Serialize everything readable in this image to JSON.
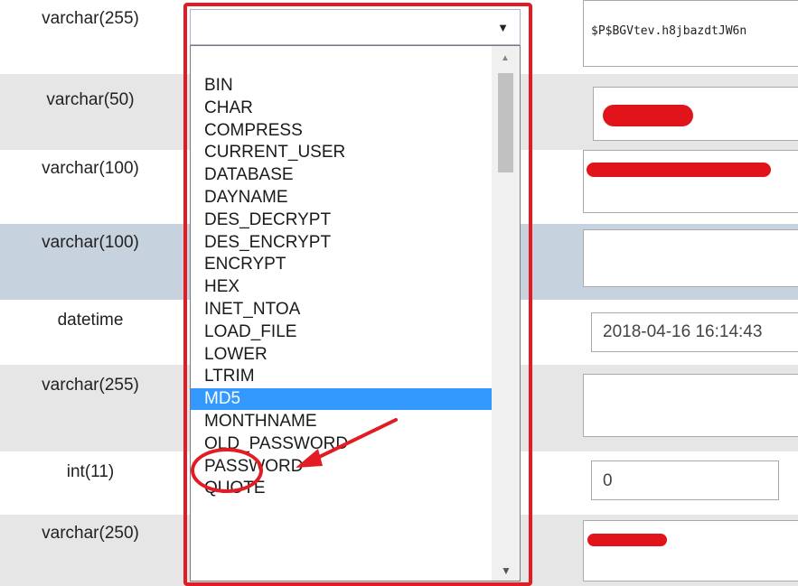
{
  "rows": [
    {
      "type": "varchar(255)",
      "value": "$P$BGVtev.h8jbazdtJW6n"
    },
    {
      "type": "varchar(50)",
      "value": ""
    },
    {
      "type": "varchar(100)",
      "value": ""
    },
    {
      "type": "varchar(100)",
      "value": ""
    },
    {
      "type": "datetime",
      "value": "2018-04-16 16:14:43"
    },
    {
      "type": "varchar(255)",
      "value": ""
    },
    {
      "type": "int(11)",
      "value": "0"
    },
    {
      "type": "varchar(250)",
      "value": ""
    }
  ],
  "function_select": {
    "value": "",
    "arrow": "▼",
    "options": [
      "BIN",
      "CHAR",
      "COMPRESS",
      "CURRENT_USER",
      "DATABASE",
      "DAYNAME",
      "DES_DECRYPT",
      "DES_ENCRYPT",
      "ENCRYPT",
      "HEX",
      "INET_NTOA",
      "LOAD_FILE",
      "LOWER",
      "LTRIM",
      "MD5",
      "MONTHNAME",
      "OLD_PASSWORD",
      "PASSWORD",
      "QUOTE"
    ],
    "highlighted": "MD5"
  },
  "icons": {
    "scroll_up": "scroll-up-arrow-icon",
    "scroll_down": "scroll-down-arrow-icon"
  },
  "colors": {
    "highlight": "#3399ff",
    "annotation": "#e31b23",
    "row_alt": "#e6e6e6",
    "row_selected": "#c6d2dd"
  }
}
